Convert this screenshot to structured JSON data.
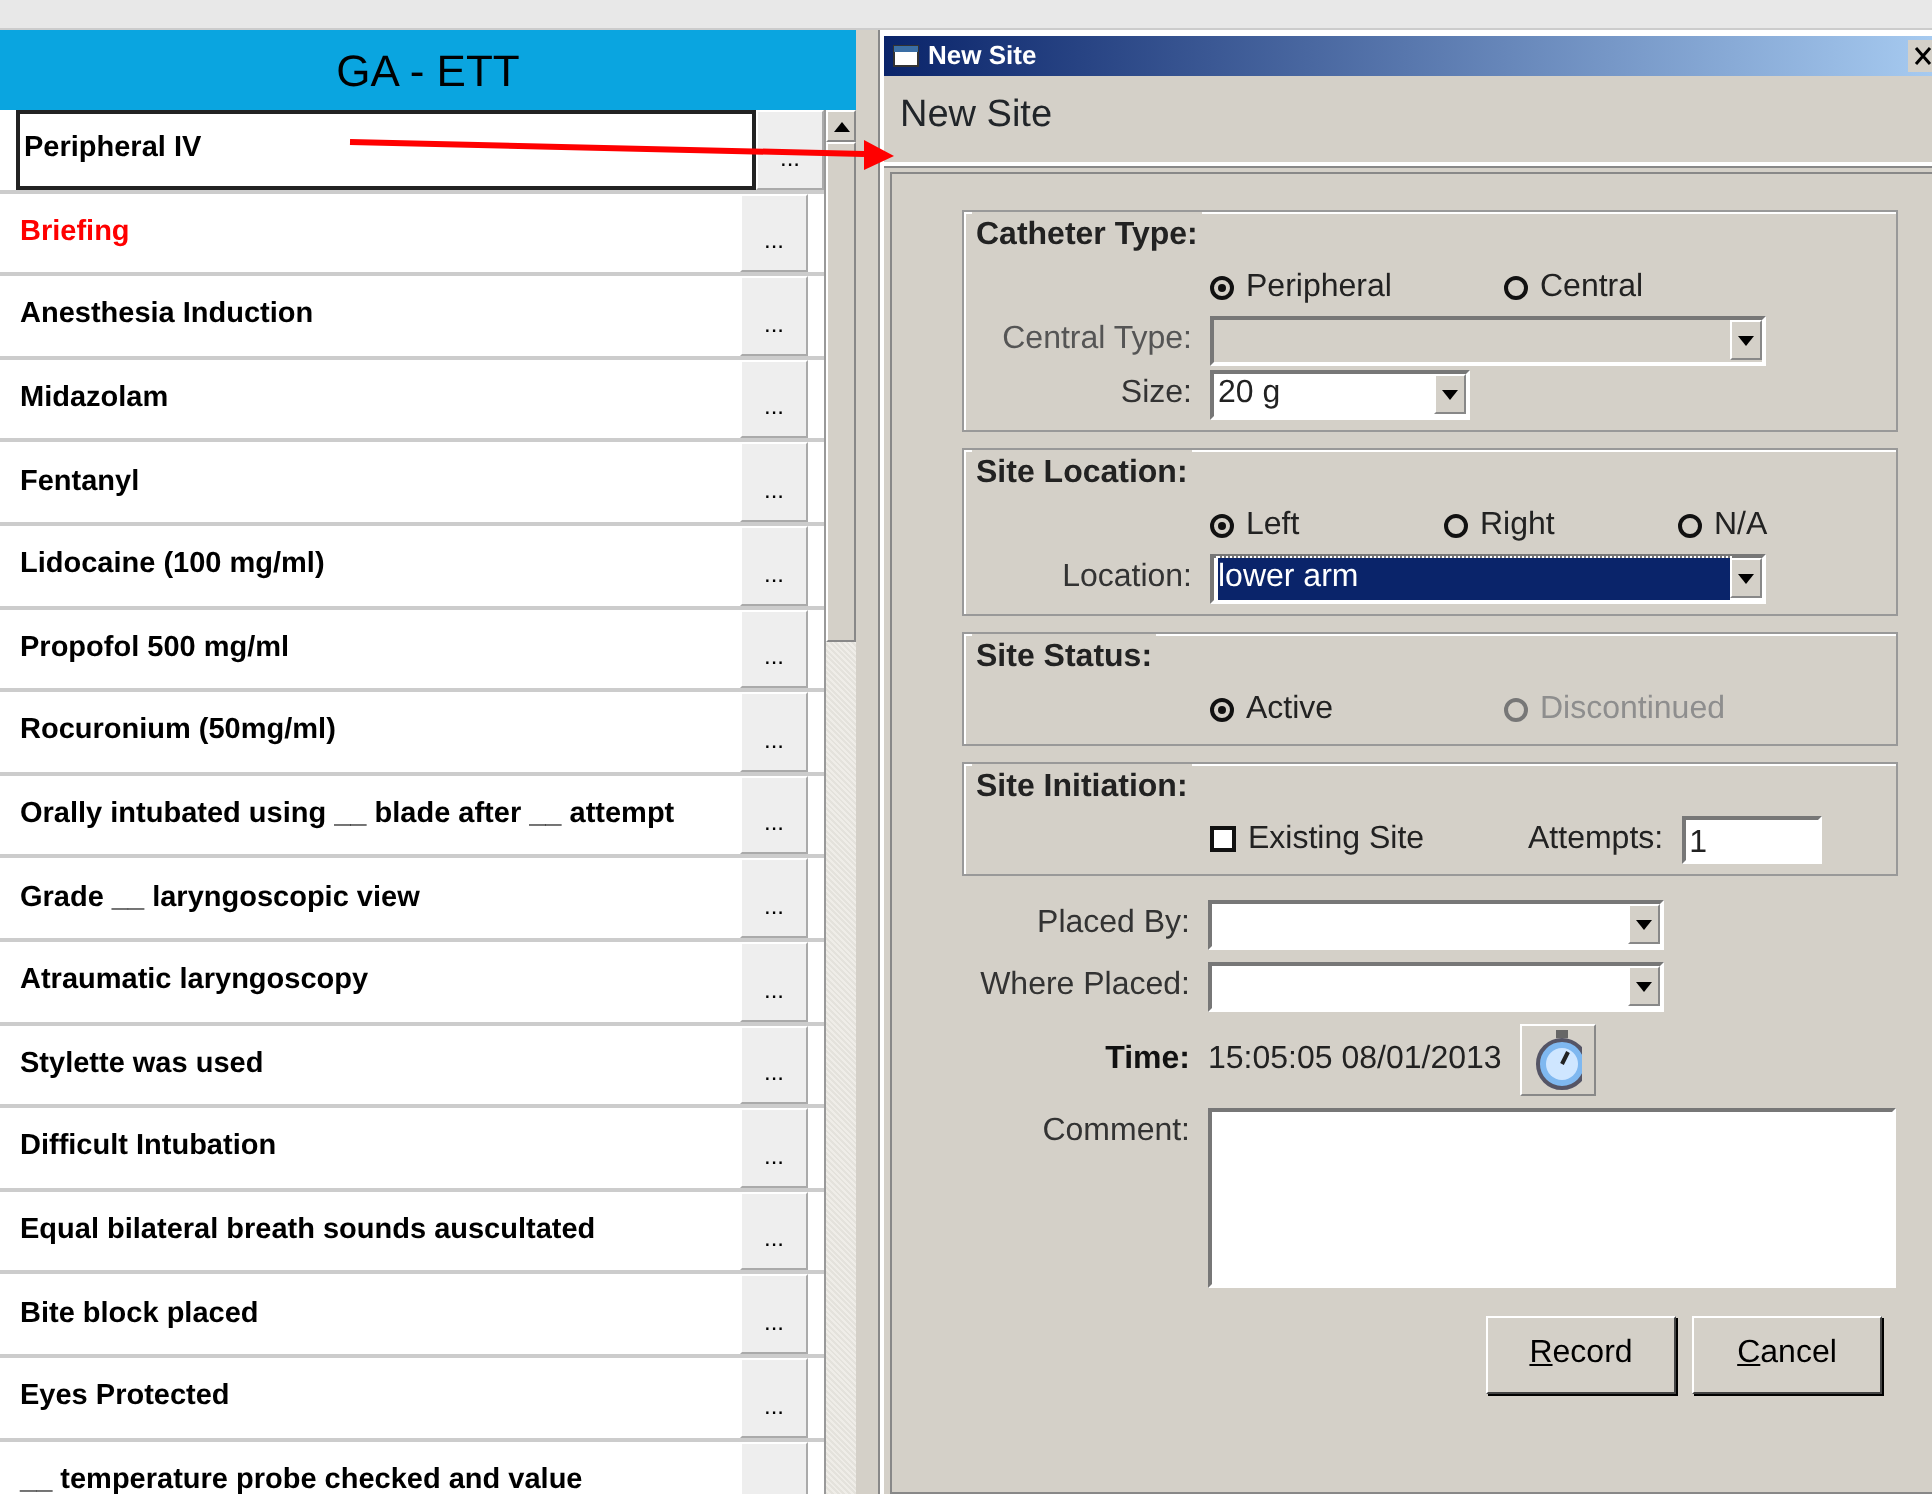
{
  "list_header": "GA - ETT",
  "list_items": [
    {
      "label": "Peripheral IV",
      "selected": true,
      "color": "#000000",
      "button": "..."
    },
    {
      "label": "Briefing",
      "selected": false,
      "color": "#ff0000",
      "button": "..."
    },
    {
      "label": "Anesthesia Induction",
      "selected": false,
      "color": "#000000",
      "button": "..."
    },
    {
      "label": "Midazolam",
      "selected": false,
      "color": "#000000",
      "button": "..."
    },
    {
      "label": "Fentanyl",
      "selected": false,
      "color": "#000000",
      "button": "..."
    },
    {
      "label": "Lidocaine (100 mg/ml)",
      "selected": false,
      "color": "#000000",
      "button": "..."
    },
    {
      "label": "Propofol 500 mg/ml",
      "selected": false,
      "color": "#000000",
      "button": "..."
    },
    {
      "label": "Rocuronium (50mg/ml)",
      "selected": false,
      "color": "#000000",
      "button": "..."
    },
    {
      "label": "Orally intubated using  __  blade after  __ attempt",
      "selected": false,
      "color": "#000000",
      "button": "..."
    },
    {
      "label": "Grade  __  laryngoscopic view",
      "selected": false,
      "color": "#000000",
      "button": "..."
    },
    {
      "label": "Atraumatic laryngoscopy",
      "selected": false,
      "color": "#000000",
      "button": "..."
    },
    {
      "label": "Stylette was used",
      "selected": false,
      "color": "#000000",
      "button": "..."
    },
    {
      "label": "Difficult Intubation",
      "selected": false,
      "color": "#000000",
      "button": "..."
    },
    {
      "label": "Equal bilateral breath sounds auscultated",
      "selected": false,
      "color": "#000000",
      "button": "..."
    },
    {
      "label": "Bite block placed",
      "selected": false,
      "color": "#000000",
      "button": "..."
    },
    {
      "label": "Eyes Protected",
      "selected": false,
      "color": "#000000",
      "button": "..."
    },
    {
      "label": "__  temperature probe checked and value",
      "selected": false,
      "color": "#000000"
    }
  ],
  "dialog": {
    "title": "New Site",
    "heading": "New Site",
    "groups": [
      {
        "title": "Catheter Type:",
        "rows": [
          {
            "kind": "radios",
            "options": [
              {
                "label": "Peripheral",
                "selected": true,
                "disabled": false
              },
              {
                "label": "Central",
                "selected": false,
                "disabled": false
              }
            ]
          },
          {
            "kind": "select",
            "label": "Central Type:",
            "disabled": true,
            "highlighted": false
          },
          {
            "kind": "small-select",
            "label": "Size:",
            "value": "20 g",
            "disabled": false,
            "highlighted": false
          }
        ]
      },
      {
        "title": "Site Location:",
        "rows": [
          {
            "kind": "radios",
            "options": [
              {
                "label": "Left",
                "selected": true,
                "disabled": false
              },
              {
                "label": "Right",
                "selected": false,
                "disabled": false
              },
              {
                "label": "N/A",
                "selected": false,
                "disabled": false
              }
            ]
          },
          {
            "kind": "select",
            "label": "Location:",
            "value": "lower arm",
            "disabled": false,
            "highlighted": true
          }
        ]
      },
      {
        "title": "Site Status:",
        "rows": [
          {
            "kind": "radios",
            "options": [
              {
                "label": "Active",
                "selected": true,
                "disabled": false
              },
              {
                "label": "Discontinued",
                "selected": false,
                "disabled": true
              }
            ]
          }
        ]
      },
      {
        "title": "Site Initiation:",
        "rows": [
          {
            "kind": "checkbox-field",
            "checkbox": {
              "label": "Existing Site",
              "checked": false
            },
            "field": {
              "label": "Attempts:",
              "value": "1"
            }
          }
        ]
      }
    ],
    "fields": [
      {
        "kind": "select",
        "label": "Placed By:"
      },
      {
        "kind": "select",
        "label": "Where Placed:"
      },
      {
        "kind": "time",
        "label": "Time:",
        "value": "15:05:05 08/01/2013"
      },
      {
        "kind": "textarea",
        "label": "Comment:"
      }
    ],
    "buttons": [
      "Record",
      "Cancel"
    ]
  }
}
